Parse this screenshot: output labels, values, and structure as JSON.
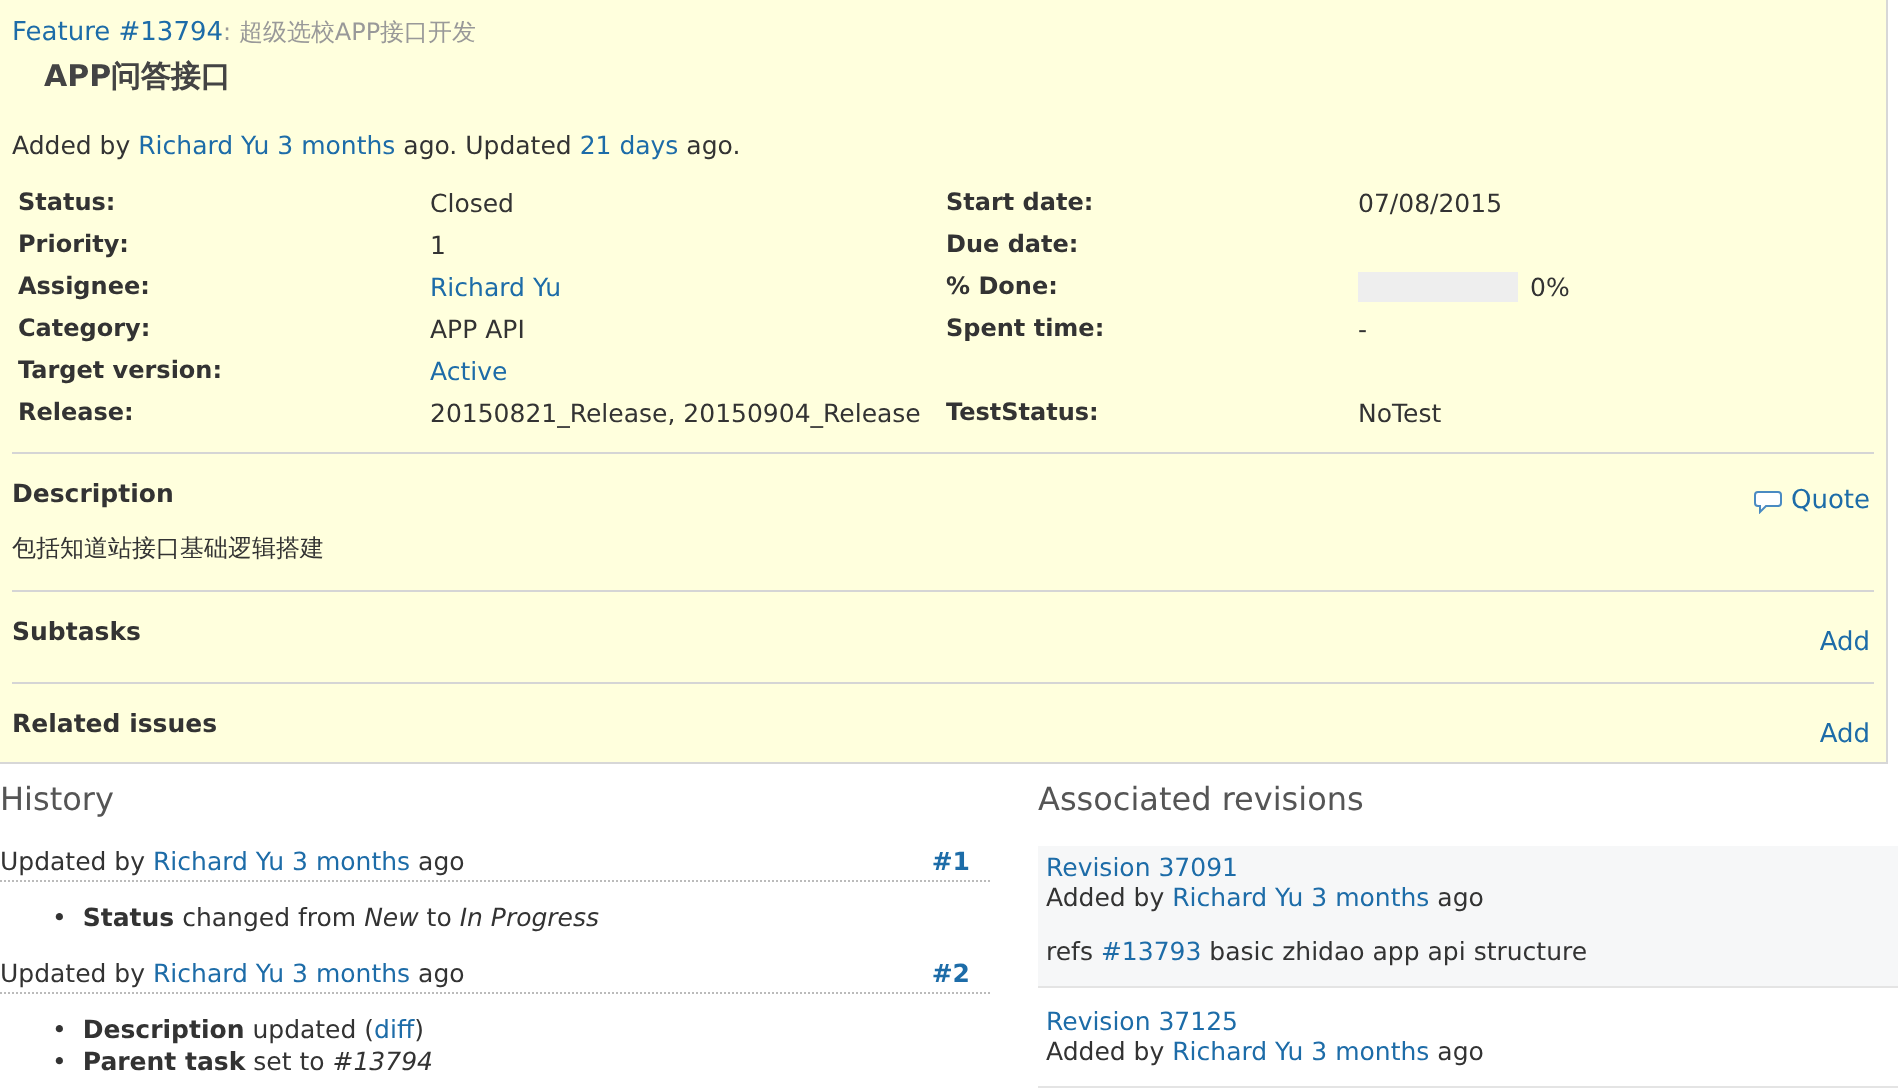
{
  "issue": {
    "tracker_link": "Feature #13794",
    "parent_subject": ": 超级选校APP接口开发",
    "subject": "APP问答接口",
    "added_line": {
      "prefix": "Added by",
      "author": "Richard Yu",
      "added": "3 months",
      "middle": "ago. Updated",
      "updated": "21 days",
      "suffix": "ago."
    },
    "attributes": [
      {
        "left": {
          "label": "Status:",
          "value": "Closed",
          "kind": "text"
        },
        "right": {
          "label": "Start date:",
          "value": "07/08/2015",
          "kind": "text"
        }
      },
      {
        "left": {
          "label": "Priority:",
          "value": "1",
          "kind": "text"
        },
        "right": {
          "label": "Due date:",
          "kind": "text"
        }
      },
      {
        "left": {
          "label": "Assignee:",
          "value": "Richard Yu",
          "kind": "link"
        },
        "right": {
          "label": "% Done:",
          "kind": "progress",
          "level": 0,
          "value": "0%"
        }
      },
      {
        "left": {
          "label": "Category:",
          "value": "APP API",
          "kind": "text"
        },
        "right": {
          "label": "Spent time:",
          "value": "-",
          "kind": "text"
        }
      },
      {
        "left": {
          "label": "Target version:",
          "value": "Active",
          "kind": "link"
        }
      },
      {
        "left": {
          "label": "Release:",
          "value": "20150821_Release, 20150904_Release",
          "kind": "text"
        },
        "right": {
          "label": "TestStatus:",
          "value": "NoTest",
          "kind": "text"
        }
      }
    ],
    "description": {
      "heading": "Description",
      "quote": "Quote",
      "text": "包括知道站接口基础逻辑搭建"
    },
    "subtasks": {
      "heading": "Subtasks",
      "action": "Add"
    },
    "related": {
      "heading": "Related issues",
      "action": "Add"
    }
  },
  "history": {
    "heading": "History",
    "journals": [
      {
        "prefix": "Updated by",
        "author": "Richard Yu",
        "when": "3 months",
        "suffix": "ago",
        "number": "#1",
        "details": [
          {
            "bullet": "•",
            "field": "Status",
            "text": "changed from *New* to *In Progress*"
          }
        ]
      },
      {
        "prefix": "Updated by",
        "author": "Richard Yu",
        "when": "3 months",
        "suffix": "ago",
        "number": "#2",
        "details": [
          {
            "bullet": "•",
            "field": "Description",
            "text": "updated (",
            "link": "diff",
            "after": ")"
          },
          {
            "bullet": "•",
            "field": "Parent task",
            "text": "set to *#13794*"
          }
        ]
      }
    ]
  },
  "revisions": {
    "heading": "Associated revisions",
    "items": [
      {
        "title": "Revision 37091",
        "prefix": "Added by",
        "author": "Richard Yu",
        "when": "3 months",
        "suffix": "ago",
        "message_prefix": "refs",
        "message_link": "#13793",
        "message_rest": "basic zhidao app api structure"
      },
      {
        "title": "Revision 37125",
        "prefix": "Added by",
        "author": "Richard Yu",
        "when": "3 months",
        "suffix": "ago"
      }
    ]
  }
}
